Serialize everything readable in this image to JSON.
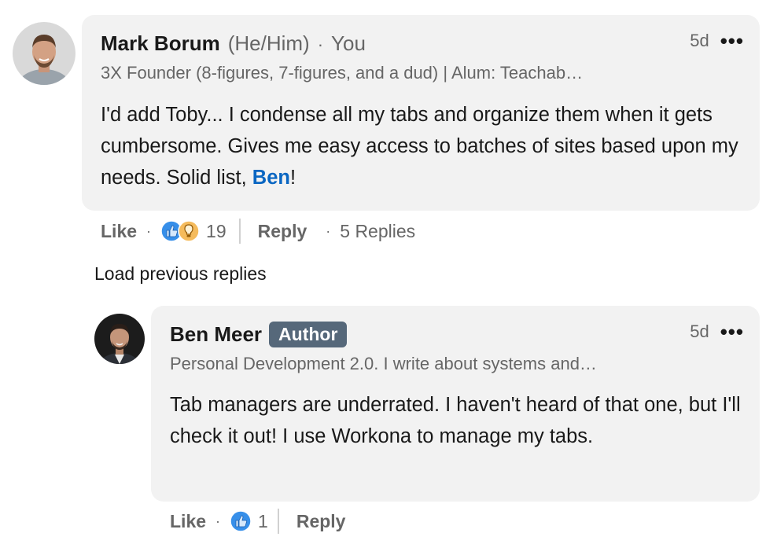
{
  "comment": {
    "name": "Mark Borum",
    "pronouns": "(He/Him)",
    "you_label": "You",
    "headline": "3X Founder (8-figures, 7-figures, and a dud) | Alum: Teachab…",
    "time": "5d",
    "more": "•••",
    "text_before": "I'd add Toby... I condense all my tabs and organize them when it gets cumbersome. Gives me easy access to batches of sites based upon my needs. Solid list, ",
    "mention": "Ben",
    "text_after": "!",
    "like_label": "Like",
    "reaction_count": "19",
    "reply_label": "Reply",
    "replies_label": "5 Replies",
    "separator": "·"
  },
  "load_previous": "Load previous replies",
  "reply": {
    "name": "Ben Meer",
    "badge": "Author",
    "headline": "Personal Development 2.0. I write about systems and…",
    "time": "5d",
    "more": "•••",
    "text": "Tab managers are underrated. I haven't heard of that one, but I'll check it out! I use Workona to manage my tabs.",
    "like_label": "Like",
    "reaction_count": "1",
    "reply_label": "Reply",
    "separator": "·"
  },
  "colors": {
    "bubble": "#f2f2f2",
    "mention": "#0a66c2",
    "badge": "#56687a",
    "like_reaction": "#378fe9",
    "insightful_reaction": "#f5bb5c"
  }
}
